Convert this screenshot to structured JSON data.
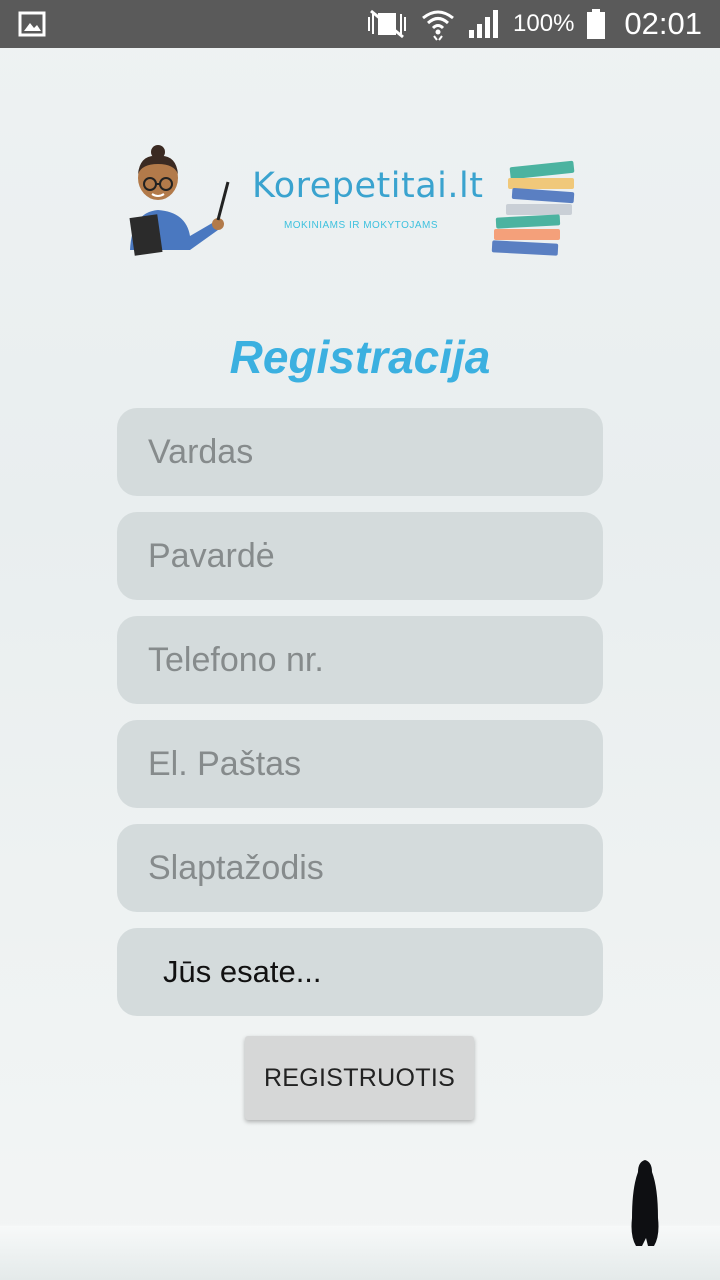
{
  "status_bar": {
    "battery_percent": "100%",
    "time": "02:01",
    "icons": [
      "gallery-icon",
      "mute-vibrate-icon",
      "wifi-icon",
      "signal-icon",
      "battery-icon"
    ]
  },
  "logo": {
    "title": "Korepetitai.lt",
    "subtitle": "MOKINIAMS IR MOKYTOJAMS"
  },
  "heading": "Registracija",
  "form": {
    "first_name_placeholder": "Vardas",
    "last_name_placeholder": "Pavardė",
    "phone_placeholder": "Telefono nr.",
    "email_placeholder": "El. Paštas",
    "password_placeholder": "Slaptažodis",
    "role_select": "Jūs esate..."
  },
  "submit_label": "REGISTRUOTIS",
  "colors": {
    "accent": "#3bb0e0",
    "field_bg": "#d4dbdc",
    "status_bar": "#5a5a5a",
    "button_bg": "#d6d7d7"
  }
}
